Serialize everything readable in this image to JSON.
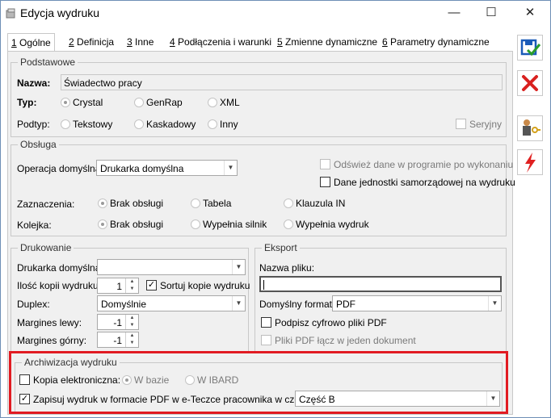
{
  "window": {
    "title": "Edycja wydruku",
    "minimize": "—",
    "maximize": "☐",
    "close": "✕"
  },
  "tabs": [
    {
      "key": "1",
      "label": " Ogólne"
    },
    {
      "key": "2",
      "label": " Definicja"
    },
    {
      "key": "3",
      "label": " Inne"
    },
    {
      "key": "4",
      "label": " Podłączenia i warunki"
    },
    {
      "key": "5",
      "label": " Zmienne dynamiczne"
    },
    {
      "key": "6",
      "label": " Parametry dynamiczne"
    }
  ],
  "podstawowe": {
    "title": "Podstawowe",
    "nazwa_label": "Nazwa:",
    "nazwa_value": "Świadectwo pracy",
    "typ_label": "Typ:",
    "typ_options": [
      "Crystal",
      "GenRap",
      "XML"
    ],
    "podtyp_label": "Podtyp:",
    "podtyp_options": [
      "Tekstowy",
      "Kaskadowy",
      "Inny"
    ],
    "seryjny": "Seryjny"
  },
  "obsluga": {
    "title": "Obsługa",
    "operacja_label": "Operacja domyślna:",
    "operacja_value": "Drukarka domyślna",
    "odswiez": "Odśwież dane w programie po wykonaniu",
    "dane_jst": "Dane jednostki samorządowej na wydruku",
    "zaznaczenia_label": "Zaznaczenia:",
    "zaznaczenia_options": [
      "Brak obsługi",
      "Tabela",
      "Klauzula IN"
    ],
    "kolejka_label": "Kolejka:",
    "kolejka_options": [
      "Brak obsługi",
      "Wypełnia silnik",
      "Wypełnia wydruk"
    ]
  },
  "drukowanie": {
    "title": "Drukowanie",
    "drukarka_label": "Drukarka domyślna:",
    "ilosc_label": "Ilość kopii wydruku:",
    "ilosc_value": "1",
    "sortuj": "Sortuj kopie wydruku",
    "duplex_label": "Duplex:",
    "duplex_value": "Domyślnie",
    "margines_lewy_label": "Margines lewy:",
    "margines_lewy_value": "-1",
    "margines_gorny_label": "Margines górny:",
    "margines_gorny_value": "-1"
  },
  "eksport": {
    "title": "Eksport",
    "nazwa_pliku_label": "Nazwa pliku:",
    "nazwa_pliku_value": "",
    "format_label": "Domyślny format:",
    "format_value": "PDF",
    "podpisz": "Podpisz cyfrowo pliki PDF",
    "pliki_pdf": "Pliki PDF łącz w jeden dokument"
  },
  "archiwizacja": {
    "title": "Archiwizacja wydruku",
    "kopia_label": "Kopia elektroniczna:",
    "w_bazie": "W bazie",
    "w_ibard": "W IBARD",
    "zapisuj_label": "Zapisuj wydruk w formacie PDF w e-Teczce pracownika w części:",
    "czesc_value": "Część B"
  },
  "colors": {
    "highlight": "#e11b22",
    "save": "#1a5bb8",
    "cancel": "#d9211f"
  }
}
